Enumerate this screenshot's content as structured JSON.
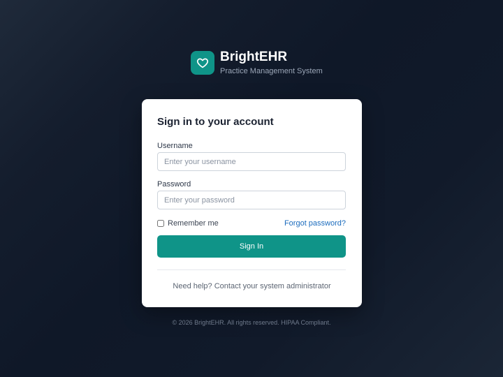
{
  "brand": {
    "name": "BrightEHR",
    "tagline": "Practice Management System",
    "logo_icon": "heart-icon",
    "accent_color": "#0f9488"
  },
  "login": {
    "title": "Sign in to your account",
    "username": {
      "label": "Username",
      "placeholder": "Enter your username",
      "value": ""
    },
    "password": {
      "label": "Password",
      "placeholder": "Enter your password",
      "value": ""
    },
    "remember_label": "Remember me",
    "remember_checked": false,
    "forgot_label": "Forgot password?",
    "forgot_color": "#1a6bbd",
    "submit_label": "Sign In",
    "help_text": "Need help? Contact your system administrator"
  },
  "footer": {
    "text": "© 2026 BrightEHR. All rights reserved. HIPAA Compliant."
  }
}
